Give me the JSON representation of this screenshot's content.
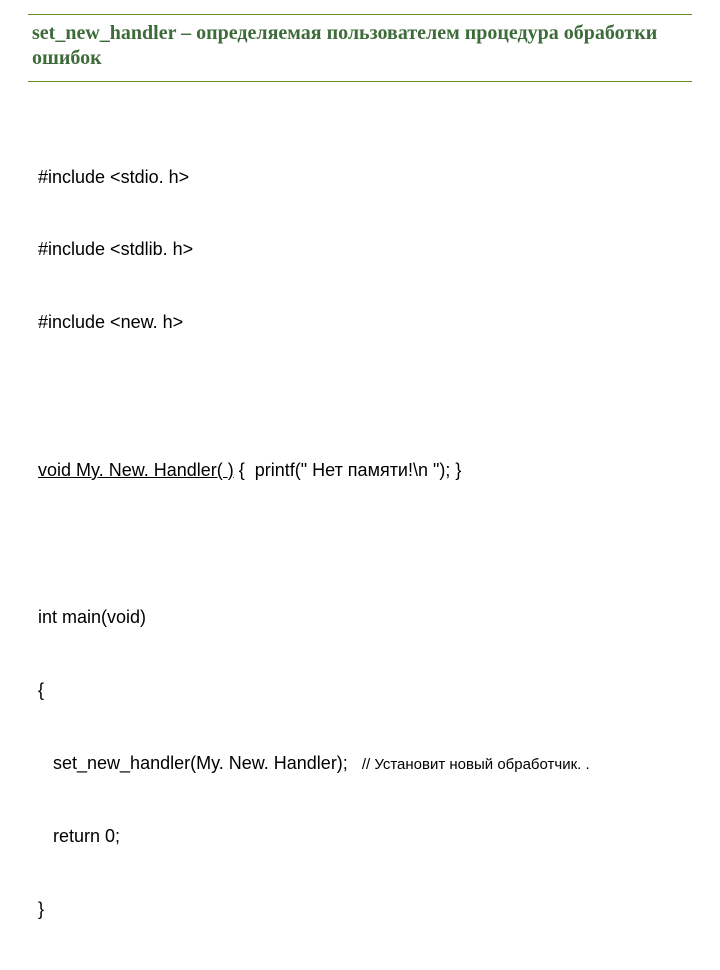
{
  "title": {
    "strong": "set_new_handler",
    "rest": " – определяемая пользователем процедура обработки ошибок"
  },
  "includes": {
    "l1": "#include <stdio. h>",
    "l2": "#include <stdlib. h>",
    "l3": "#include <new. h>"
  },
  "handler": {
    "decl_prefix": "void",
    "decl_name": " My. New. Handler( )",
    "body": " {  printf(\" Нет памяти!\\n \"); }"
  },
  "main": {
    "l1": "int main(void)",
    "l2": "{",
    "l3": "   set_new_handler(My. New. Handler);",
    "comment": "// Установит новый обработчик. .",
    "l4": "   return 0;",
    "l5": "}"
  }
}
